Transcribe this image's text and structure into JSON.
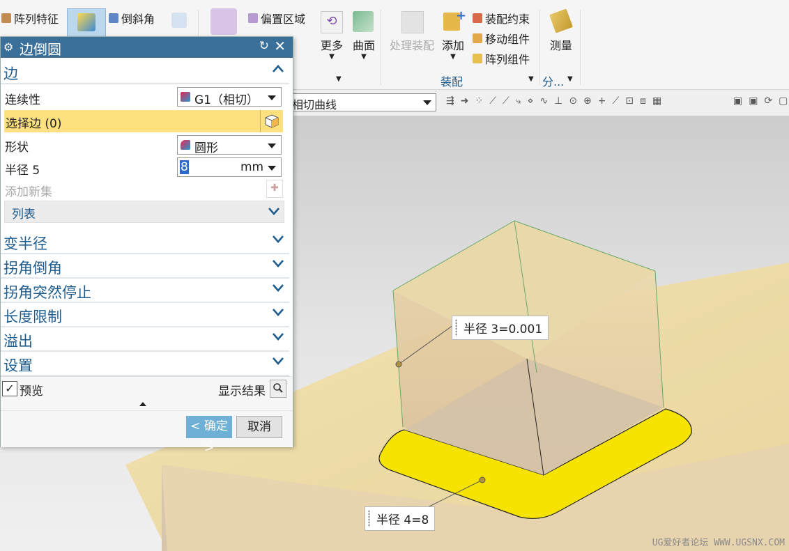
{
  "ribbon": {
    "items": {
      "array_feature": "阵列特征",
      "chamfer": "倒斜角",
      "offset_region": "偏置区域",
      "more": "更多",
      "surface": "曲面",
      "process_assembly": "处理装配",
      "add": "添加",
      "assembly_constraint": "装配约束",
      "move_component": "移动组件",
      "array_component": "阵列组件",
      "measure": "测量"
    },
    "groups": {
      "assembly": "装配",
      "analysis": "分..."
    }
  },
  "selection_bar": {
    "curve_rule": "相切曲线"
  },
  "dialog": {
    "title": "边倒圆",
    "sections": {
      "edge": "边",
      "variable_radius": "变半径",
      "corner_chamfer": "拐角倒角",
      "corner_stopback": "拐角突然停止",
      "length_limit": "长度限制",
      "overflow": "溢出",
      "settings": "设置"
    },
    "edge": {
      "continuity_label": "连续性",
      "continuity_value": "G1（相切）",
      "select_edge_label": "选择边 (0)",
      "shape_label": "形状",
      "shape_value": "圆形",
      "radius_label": "半径 5",
      "radius_value": "8",
      "radius_unit": "mm",
      "add_new_set": "添加新集",
      "list": "列表"
    },
    "preview_label": "预览",
    "preview_checked": true,
    "show_result": "显示结果",
    "ok": "< 确定 >",
    "cancel": "取消"
  },
  "viewport": {
    "callout_radius3": "半径 3=0.001",
    "callout_radius4": "半径 4=8",
    "watermark": "UG爱好者论坛 WWW.UGSNX.COM"
  },
  "colors": {
    "title_bar": "#3a6f9a",
    "section_text": "#1f5d8f",
    "selection_highlight": "#fde07f",
    "fillet_yellow": "#f6e400",
    "ok_button": "#6fb0d6"
  }
}
